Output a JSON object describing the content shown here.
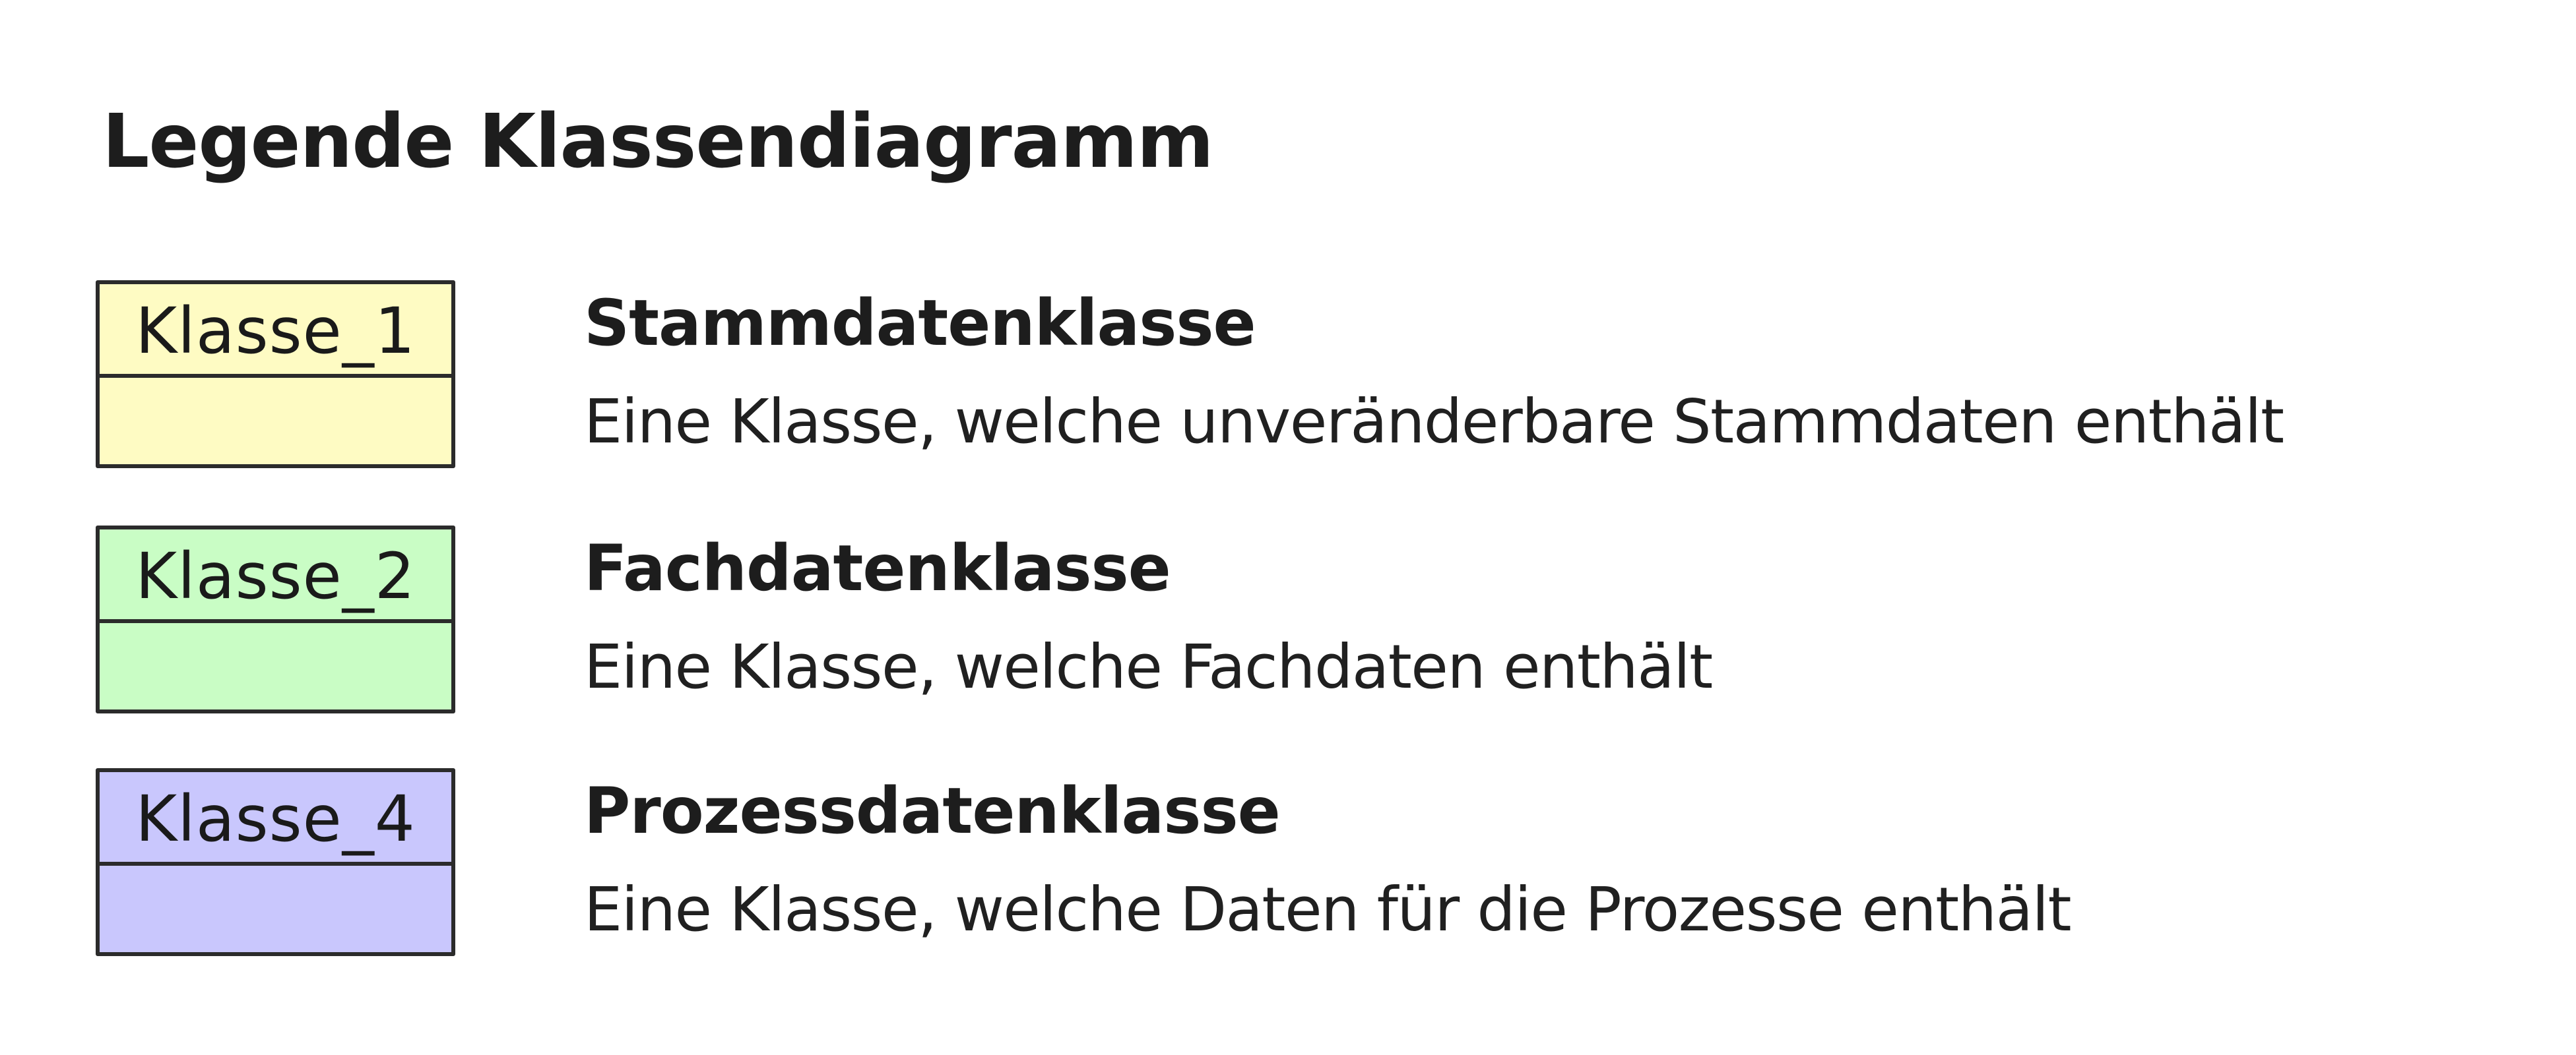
{
  "title": "Legende Klassendiagramm",
  "legend": [
    {
      "box_label": "Klasse_1",
      "fill_color": "#fefbc3",
      "heading": "Stammdatenklasse",
      "description": "Eine Klasse, welche unveränderbare Stammdaten enthält"
    },
    {
      "box_label": "Klasse_2",
      "fill_color": "#c9fdc5",
      "heading": "Fachdatenklasse",
      "description": "Eine Klasse, welche Fachdaten enthält"
    },
    {
      "box_label": "Klasse_4",
      "fill_color": "#c9c7fd",
      "heading": "Prozessdatenklasse",
      "description": "Eine Klasse, welche Daten für die Prozesse enthält"
    }
  ]
}
